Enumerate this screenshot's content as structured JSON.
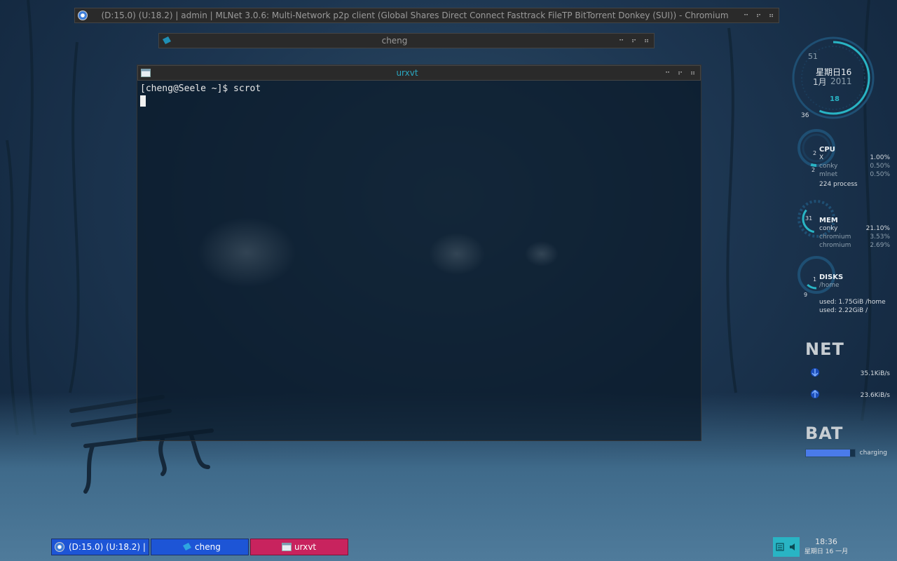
{
  "windows": {
    "chromium": {
      "title": "(D:15.0) (U:18.2) | admin | MLNet 3.0.6: Multi-Network p2p client (Global Shares Direct Connect Fasttrack FileTP BitTorrent Donkey (SUI)) - Chromium"
    },
    "cheng": {
      "title": "cheng"
    },
    "urxvt": {
      "title": "urxvt",
      "prompt_line": "[cheng@Seele ~]$ scrot"
    }
  },
  "window_buttons": [
    "⠒",
    "⠖",
    "⠶"
  ],
  "conky": {
    "clock": {
      "weekday_day": "星期日16",
      "month_year_month": "1月",
      "year": "2011",
      "seconds": "18",
      "minute_mark": "51",
      "hour_mark": "36"
    },
    "cpu": {
      "label": "CPU",
      "core1": "2",
      "core2": "2",
      "rows": [
        {
          "name": "X",
          "value": "1.00%"
        },
        {
          "name": "conky",
          "value": "0.50%"
        },
        {
          "name": "mlnet",
          "value": "0.50%"
        }
      ],
      "process_count": "224 process"
    },
    "mem": {
      "label": "MEM",
      "ring_value": "31",
      "rows": [
        {
          "name": "conky",
          "value": "21.10%"
        },
        {
          "name": "chromium",
          "value": "3.53%"
        },
        {
          "name": "chromium",
          "value": "2.69%"
        }
      ]
    },
    "disks": {
      "label": "DISKS",
      "mount": "/home",
      "ring_a": "1",
      "ring_b": "9",
      "used_home": "used: 1.75GiB /home",
      "used_root": "used: 2.22GiB /"
    },
    "net": {
      "label": "NET",
      "down": "35.1KiB/s",
      "up": "23.6KiB/s"
    },
    "bat": {
      "label": "BAT",
      "status": "charging",
      "level": 0.9
    }
  },
  "taskbar": {
    "tasks": [
      {
        "label": "(D:15.0) (U:18.2) | ⋯"
      },
      {
        "label": "cheng"
      },
      {
        "label": "urxvt"
      }
    ],
    "clock_time": "18:36",
    "clock_date": "星期日 16 一月"
  },
  "colors": {
    "accent": "#29b4c4",
    "task_active": "#c8235e",
    "task_inactive": "#1d55d6",
    "battery": "#4a7bea"
  },
  "icons": {
    "chromium": "chromium-icon",
    "cheng": "folder-icon",
    "urxvt": "terminal-icon",
    "net_down": "arrow-down-icon",
    "net_up": "arrow-up-icon",
    "tray_keyboard": "keyboard-icon",
    "tray_volume": "volume-icon"
  }
}
